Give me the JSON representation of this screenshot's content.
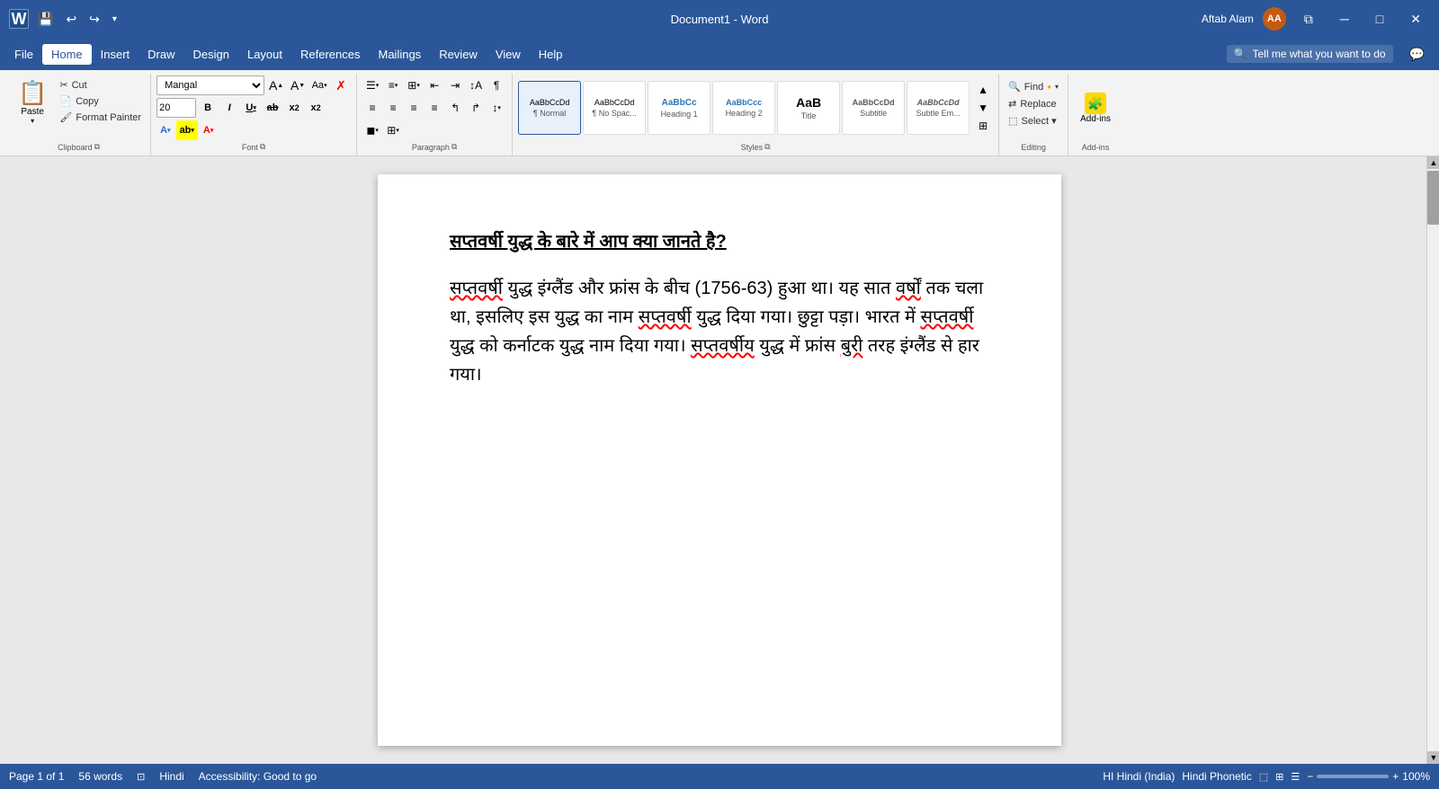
{
  "titlebar": {
    "app_name": "Document1 - Word",
    "user_name": "Aftab Alam",
    "user_initials": "AA",
    "qat": {
      "save": "💾",
      "undo": "↩",
      "redo": "↪",
      "customize": "▾"
    }
  },
  "menubar": {
    "items": [
      "File",
      "Home",
      "Insert",
      "Draw",
      "Design",
      "Layout",
      "References",
      "Mailings",
      "Review",
      "View",
      "Help"
    ],
    "active": "Home",
    "search_placeholder": "Tell me what you want to do",
    "search_icon": "🔍"
  },
  "ribbon": {
    "clipboard": {
      "label": "Clipboard",
      "paste_label": "Paste",
      "cut_label": "Cut",
      "copy_label": "Copy",
      "format_painter_label": "Format Painter"
    },
    "font": {
      "label": "Font",
      "font_name": "Mangal",
      "font_size": "20",
      "bold": "B",
      "italic": "I",
      "underline": "U",
      "strikethrough": "S",
      "subscript": "x₂",
      "superscript": "x²",
      "grow": "A",
      "shrink": "A",
      "change_case": "Aa",
      "clear_format": "✗",
      "font_color_icon": "A",
      "highlight_icon": "ab"
    },
    "paragraph": {
      "label": "Paragraph"
    },
    "styles": {
      "label": "Styles",
      "items": [
        {
          "name": "normal",
          "preview": "AaBbCcDd",
          "label": "¶ Normal"
        },
        {
          "name": "no-spacing",
          "preview": "AaBbCcDd",
          "label": "¶ No Spac..."
        },
        {
          "name": "heading1",
          "preview": "AaBbCc",
          "label": "Heading 1"
        },
        {
          "name": "heading2",
          "preview": "AaBbCcc",
          "label": "Heading 2"
        },
        {
          "name": "title",
          "preview": "AaB",
          "label": "Title"
        },
        {
          "name": "subtitle",
          "preview": "AaBbCcDd",
          "label": "Subtitle"
        },
        {
          "name": "subtle-em",
          "preview": "AaBbCcDd",
          "label": "Subtle Em..."
        }
      ]
    },
    "editing": {
      "label": "Editing",
      "find_label": "Find",
      "replace_label": "Replace",
      "select_label": "Select ▾"
    },
    "addins": {
      "label": "Add-ins",
      "btn_label": "Add-ins"
    }
  },
  "document": {
    "heading": "सप्तवर्षी युद्ध के बारे में आप क्या जानते है?",
    "body": "सप्तवर्षी युद्ध इंग्लैंड और फ्रांस के बीच (1756-63) हुआ था। यह सात वर्षों तक चला था, इसलिए इस युद्ध का नाम सप्तवर्षी युद्ध दिया गया। छुट्टा पड़ा। भारत में सप्तवर्षी युद्ध को कर्नाटक युद्ध नाम दिया गया। सप्तवर्षीय युद्ध में फ्रांस बुरी तरह इंग्लैंड से हार गया।"
  },
  "statusbar": {
    "page_info": "Page 1 of 1",
    "word_count": "56 words",
    "language": "Hindi",
    "accessibility": "Accessibility: Good to go",
    "input_method1": "HI Hindi (India)",
    "input_method2": "Hindi Phonetic",
    "zoom": "100%"
  }
}
